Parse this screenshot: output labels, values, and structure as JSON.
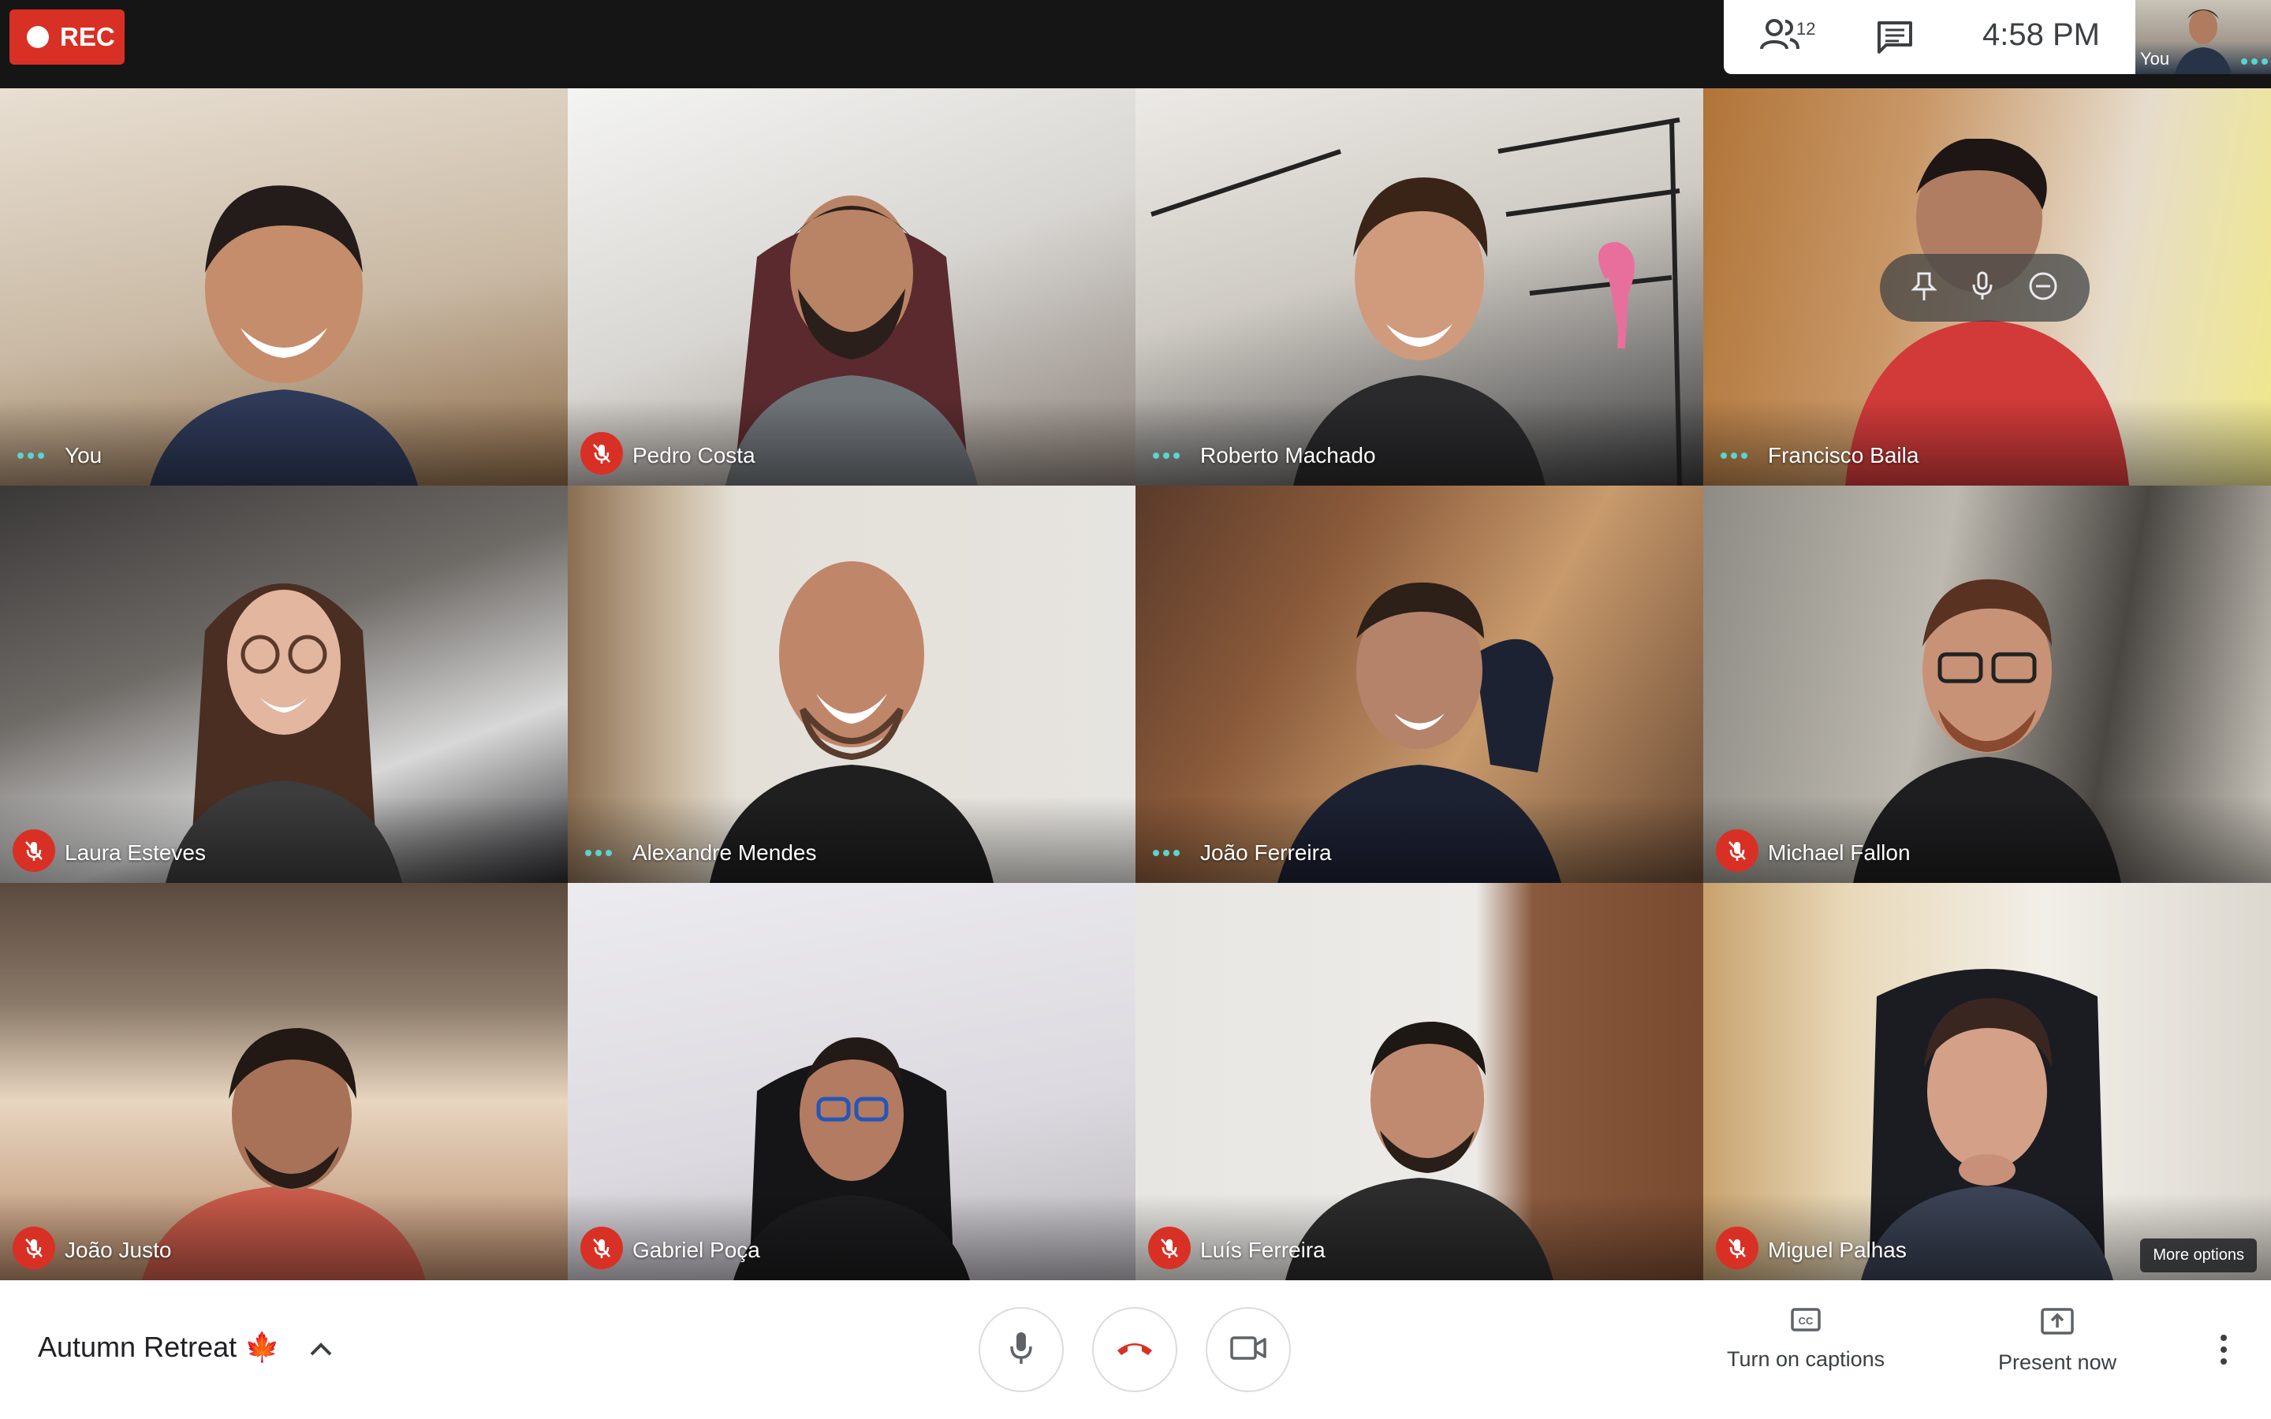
{
  "top_bar": {
    "rec_label": "REC",
    "participants_icon": "people-icon",
    "participants_count": "12",
    "chat_icon": "chat-icon",
    "clock": "4:58 PM",
    "self_view_label": "You"
  },
  "participants": [
    {
      "name": "You",
      "status": "speaking-dots"
    },
    {
      "name": "Pedro Costa",
      "status": "muted"
    },
    {
      "name": "Roberto Machado",
      "status": "speaking-dots"
    },
    {
      "name": "Francisco Baila",
      "status": "speaking-dots"
    },
    {
      "name": "Laura Esteves",
      "status": "muted"
    },
    {
      "name": "Alexandre Mendes",
      "status": "speaking-dots"
    },
    {
      "name": "João Ferreira",
      "status": "speaking-dots"
    },
    {
      "name": "Michael Fallon",
      "status": "muted"
    },
    {
      "name": "João Justo",
      "status": "muted"
    },
    {
      "name": "Gabriel Poça",
      "status": "muted"
    },
    {
      "name": "Luís Ferreira",
      "status": "muted"
    },
    {
      "name": "Miguel Palhas",
      "status": "muted"
    }
  ],
  "tile_overlay": {
    "icons": [
      "pin-icon",
      "microphone-icon",
      "remove-icon"
    ],
    "more_options_label": "More options"
  },
  "bottom_bar": {
    "meeting_name": "Autumn Retreat",
    "meeting_emoji": "🍁",
    "mic_icon": "microphone-icon",
    "hangup_icon": "hang-up-icon",
    "camera_icon": "camera-icon",
    "captions_label": "Turn on captions",
    "present_label": "Present now",
    "more_icon": "more-vert-icon"
  },
  "colors": {
    "rec_red": "#d93025",
    "muted_red": "#d93025",
    "speaking_teal": "#5bd3cf",
    "top_bar_bg": "#151515"
  }
}
